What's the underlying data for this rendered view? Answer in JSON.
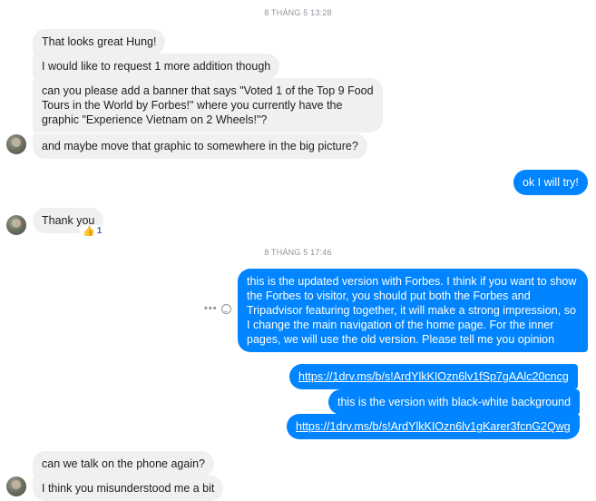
{
  "timestamps": [
    "8 THÁNG 5 13:28",
    "8 THÁNG 5 17:46"
  ],
  "messages": [
    {
      "text": "That looks great Hung!"
    },
    {
      "text": "I would like to request 1 more addition though"
    },
    {
      "text": "can you please add a banner that says \"Voted 1 of the Top 9 Food Tours in the World by Forbes!\" where you currently have the graphic \"Experience Vietnam on 2 Wheels!\"?"
    },
    {
      "text": "and maybe move that graphic to somewhere in the big picture?"
    },
    {
      "text": "ok I will try!"
    },
    {
      "text": "Thank you"
    },
    {
      "text": "this is the updated version with Forbes. I think if you want to show the Forbes to visitor, you should put both the Forbes and Tripadvisor featuring together, it will make a strong impression, so I change the main navigation of the home page. For the inner pages, we will use the old version. Please tell me you opinion"
    },
    {
      "text": "https://1drv.ms/b/s!ArdYlkKIOzn6lv1fSp7gAAlc20cncg"
    },
    {
      "text": "this is the version with black-white background"
    },
    {
      "text": "https://1drv.ms/b/s!ArdYlkKIOzn6lv1gKarer3fcnG2Qwg"
    },
    {
      "text": "can we talk on the phone again?"
    },
    {
      "text": "I think you misunderstood me a bit"
    }
  ],
  "reaction": {
    "icon": "thumbs-up-icon",
    "count": "1"
  },
  "colors": {
    "outgoing": "#0084ff",
    "incoming": "#f1f0f0",
    "timestamp": "#90949c"
  }
}
